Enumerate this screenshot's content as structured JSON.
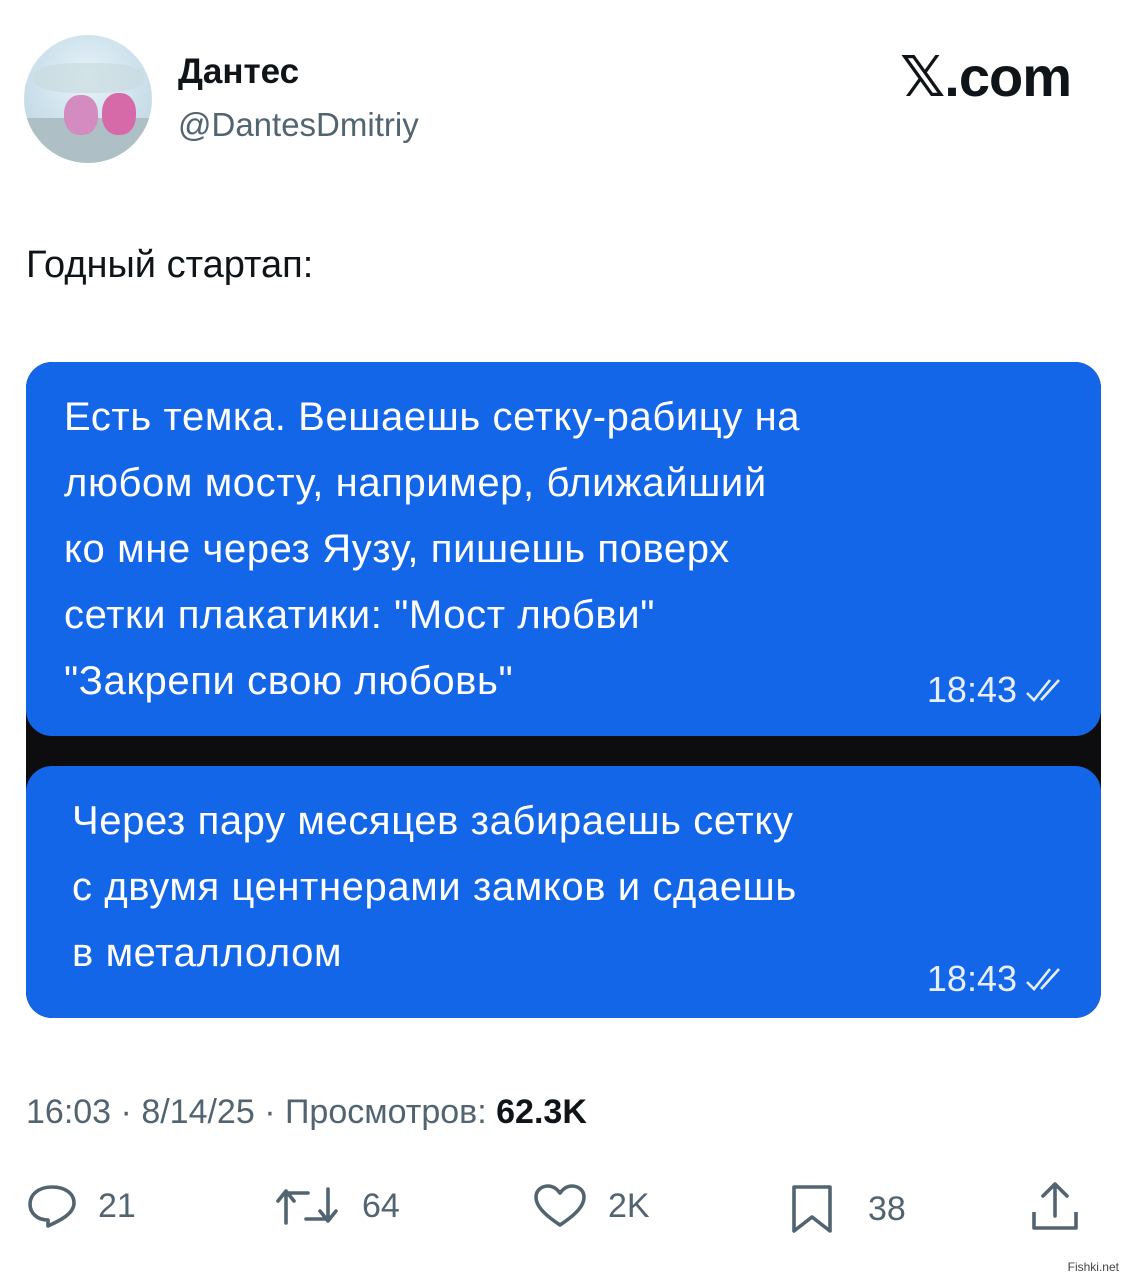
{
  "author": {
    "display_name": "Дантес",
    "handle": "@DantesDmitriy"
  },
  "brand": "𝕏.com",
  "tweet_text": "Годный стартап:",
  "chat": {
    "messages": [
      {
        "text": "Есть темка. Вешаешь сетку-рабицу на\nлюбом мосту, например, ближайший\nко мне через Яузу, пишешь поверх\nсетки плакатики: \"Мост любви\"\n\"Закрепи свою любовь\"",
        "time": "18:43"
      },
      {
        "text": "Через пару месяцев забираешь сетку\nс двумя центнерами замков и сдаешь\nв металлолом",
        "time": "18:43"
      }
    ]
  },
  "meta": {
    "time": "16:03",
    "date": "8/14/25",
    "views_label": "Просмотров:",
    "views_count": "62.3K"
  },
  "actions": {
    "replies": "21",
    "reposts": "64",
    "likes": "2K",
    "bookmarks": "38"
  },
  "watermark": "Fishki.net",
  "colors": {
    "bubble": "#1466e8",
    "chat_background": "#0d0d0f",
    "secondary_text": "#536471"
  }
}
